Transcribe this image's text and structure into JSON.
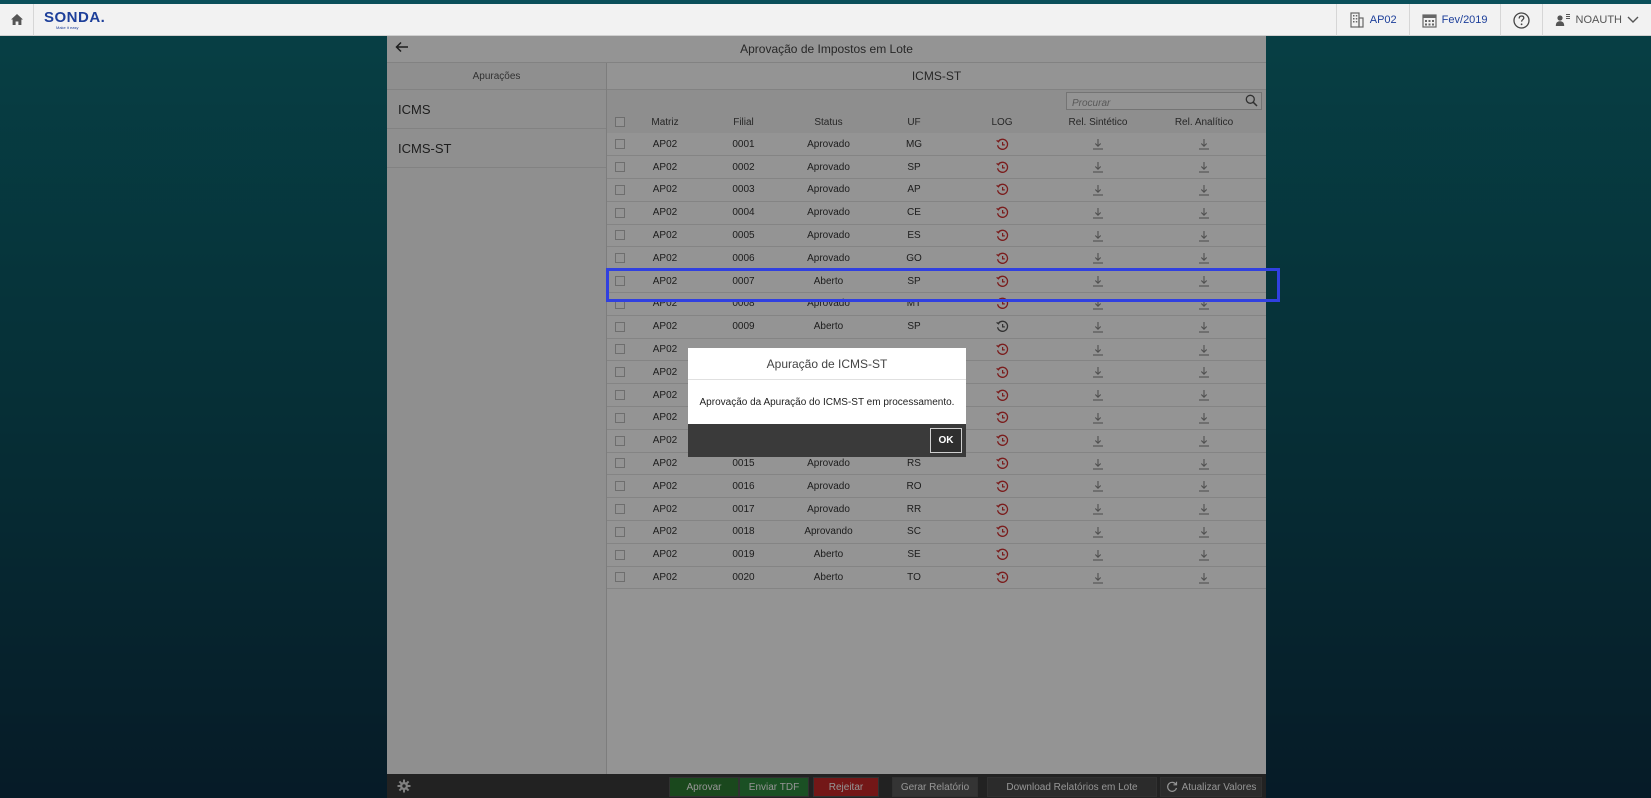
{
  "topbar": {
    "logo_text": "SONDA.",
    "logo_subtext": "Make it easy",
    "company": "AP02",
    "period": "Fev/2019",
    "user": "NOAUTH"
  },
  "app": {
    "title": "Aprovação de Impostos em Lote"
  },
  "left": {
    "header": "Apurações",
    "items": [
      {
        "label": "ICMS"
      },
      {
        "label": "ICMS-ST"
      }
    ]
  },
  "right": {
    "header": "ICMS-ST",
    "search_placeholder": "Procurar",
    "columns": [
      "Matriz",
      "Filial",
      "Status",
      "UF",
      "LOG",
      "Rel. Sintético",
      "Rel. Analítico"
    ],
    "rows": [
      {
        "matriz": "AP02",
        "filial": "0001",
        "status": "Aprovado",
        "uf": "MG",
        "log_state": "error"
      },
      {
        "matriz": "AP02",
        "filial": "0002",
        "status": "Aprovado",
        "uf": "SP",
        "log_state": "error"
      },
      {
        "matriz": "AP02",
        "filial": "0003",
        "status": "Aprovado",
        "uf": "AP",
        "log_state": "error"
      },
      {
        "matriz": "AP02",
        "filial": "0004",
        "status": "Aprovado",
        "uf": "CE",
        "log_state": "error"
      },
      {
        "matriz": "AP02",
        "filial": "0005",
        "status": "Aprovado",
        "uf": "ES",
        "log_state": "error"
      },
      {
        "matriz": "AP02",
        "filial": "0006",
        "status": "Aprovado",
        "uf": "GO",
        "log_state": "error"
      },
      {
        "matriz": "AP02",
        "filial": "0007",
        "status": "Aberto",
        "uf": "SP",
        "log_state": "error"
      },
      {
        "matriz": "AP02",
        "filial": "0008",
        "status": "Aprovado",
        "uf": "MT",
        "log_state": "error"
      },
      {
        "matriz": "AP02",
        "filial": "0009",
        "status": "Aberto",
        "uf": "SP",
        "log_state": "neutral"
      },
      {
        "matriz": "AP02",
        "filial": "",
        "status": "",
        "uf": "",
        "log_state": "error"
      },
      {
        "matriz": "AP02",
        "filial": "",
        "status": "",
        "uf": "",
        "log_state": "error"
      },
      {
        "matriz": "AP02",
        "filial": "",
        "status": "",
        "uf": "",
        "log_state": "error"
      },
      {
        "matriz": "AP02",
        "filial": "",
        "status": "",
        "uf": "",
        "log_state": "error"
      },
      {
        "matriz": "AP02",
        "filial": "",
        "status": "",
        "uf": "",
        "log_state": "error"
      },
      {
        "matriz": "AP02",
        "filial": "0015",
        "status": "Aprovado",
        "uf": "RS",
        "log_state": "error"
      },
      {
        "matriz": "AP02",
        "filial": "0016",
        "status": "Aprovado",
        "uf": "RO",
        "log_state": "error"
      },
      {
        "matriz": "AP02",
        "filial": "0017",
        "status": "Aprovado",
        "uf": "RR",
        "log_state": "error"
      },
      {
        "matriz": "AP02",
        "filial": "0018",
        "status": "Aprovando",
        "uf": "SC",
        "log_state": "error"
      },
      {
        "matriz": "AP02",
        "filial": "0019",
        "status": "Aberto",
        "uf": "SE",
        "log_state": "error"
      },
      {
        "matriz": "AP02",
        "filial": "0020",
        "status": "Aberto",
        "uf": "TO",
        "log_state": "error"
      }
    ]
  },
  "bottom": {
    "approve": "Aprovar",
    "send_tdf": "Enviar TDF",
    "reject": "Rejeitar",
    "generate_report": "Gerar Relatório",
    "download_reports": "Download Relatórios em Lote",
    "refresh": "Atualizar Valores"
  },
  "modal": {
    "title": "Apuração de ICMS-ST",
    "message": "Aprovação da Apuração do ICMS-ST em processamento.",
    "ok": "OK"
  },
  "colors": {
    "brand": "#1d3f9a",
    "approve_btn": "#2e7d32",
    "send_btn": "#2f8a3e",
    "reject_btn": "#c62828",
    "log_error": "#d32f2f",
    "log_neutral": "#555555",
    "highlight": "#3040e0"
  },
  "icons": {
    "home": "home-icon",
    "company": "building-icon",
    "period": "calendar-icon",
    "help": "help-icon",
    "user": "user-icon",
    "user_menu": "chevron-down-icon",
    "back": "arrow-left-icon",
    "search": "search-icon",
    "log": "history-icon",
    "download": "download-icon",
    "settings": "gear-icon",
    "refresh": "refresh-icon"
  }
}
